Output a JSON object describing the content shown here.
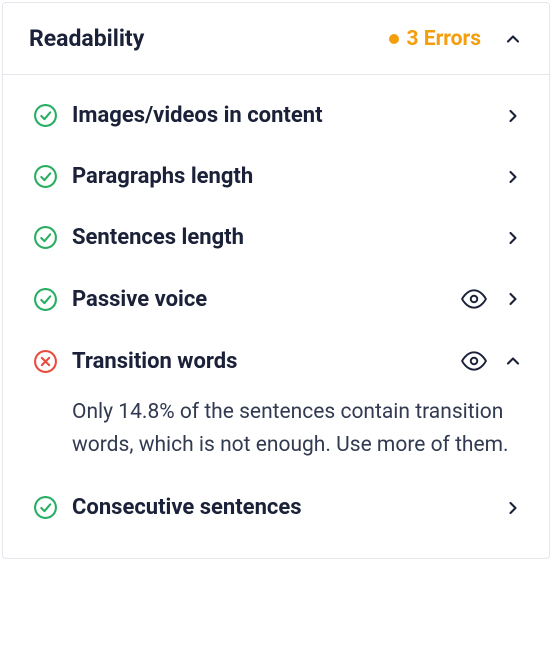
{
  "header": {
    "title": "Readability",
    "error_count": "3 Errors"
  },
  "items": [
    {
      "label": "Images/videos in content",
      "status": "pass",
      "has_eye": false,
      "expanded": false,
      "detail": ""
    },
    {
      "label": "Paragraphs length",
      "status": "pass",
      "has_eye": false,
      "expanded": false,
      "detail": ""
    },
    {
      "label": "Sentences length",
      "status": "pass",
      "has_eye": false,
      "expanded": false,
      "detail": ""
    },
    {
      "label": "Passive voice",
      "status": "pass",
      "has_eye": true,
      "expanded": false,
      "detail": ""
    },
    {
      "label": "Transition words",
      "status": "fail",
      "has_eye": true,
      "expanded": true,
      "detail": "Only 14.8% of the sentences contain transition words, which is not enough. Use more of them."
    },
    {
      "label": "Consecutive sentences",
      "status": "pass",
      "has_eye": false,
      "expanded": false,
      "detail": ""
    }
  ]
}
